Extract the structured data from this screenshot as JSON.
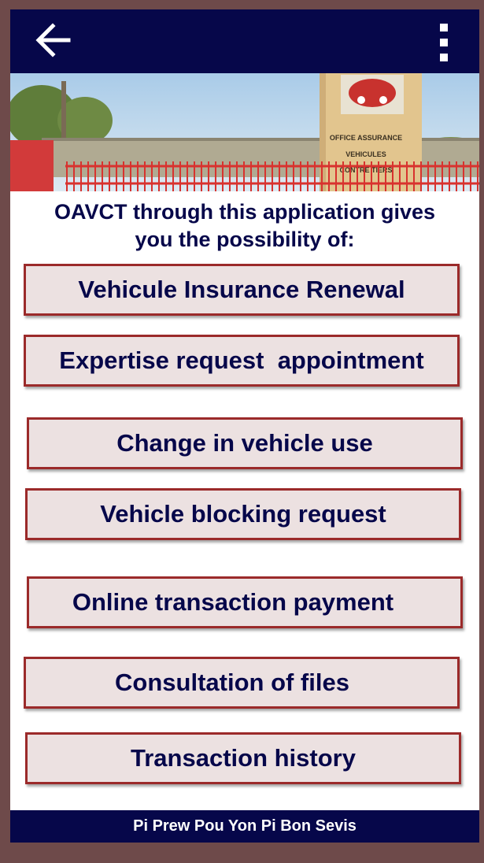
{
  "header": {
    "back_icon": "arrow-left-icon",
    "menu_icon": "more-vertical-icon",
    "bar_color": "#06074a"
  },
  "banner": {
    "sign_text": [
      "OFFICE ASSURANCE",
      "VEHICULES",
      "CONTRE TIERS"
    ]
  },
  "intro": {
    "line1": "OAVCT through this application gives",
    "line2": "you the possibility of:"
  },
  "options": [
    {
      "label": "Vehicule Insurance Renewal"
    },
    {
      "label": "Expertise request  appointment"
    },
    {
      "label": "Change in vehicle use"
    },
    {
      "label": "Vehicle blocking request"
    },
    {
      "label": "Online transaction payment"
    },
    {
      "label": "Consultation of files"
    },
    {
      "label": "Transaction history"
    }
  ],
  "footer": {
    "slogan": "Pi Prew Pou Yon Pi Bon Sevis"
  },
  "colors": {
    "navy": "#06074a",
    "button_bg": "#ece1e1",
    "button_border": "#9b2a2a",
    "frame": "#6e4a4a"
  }
}
